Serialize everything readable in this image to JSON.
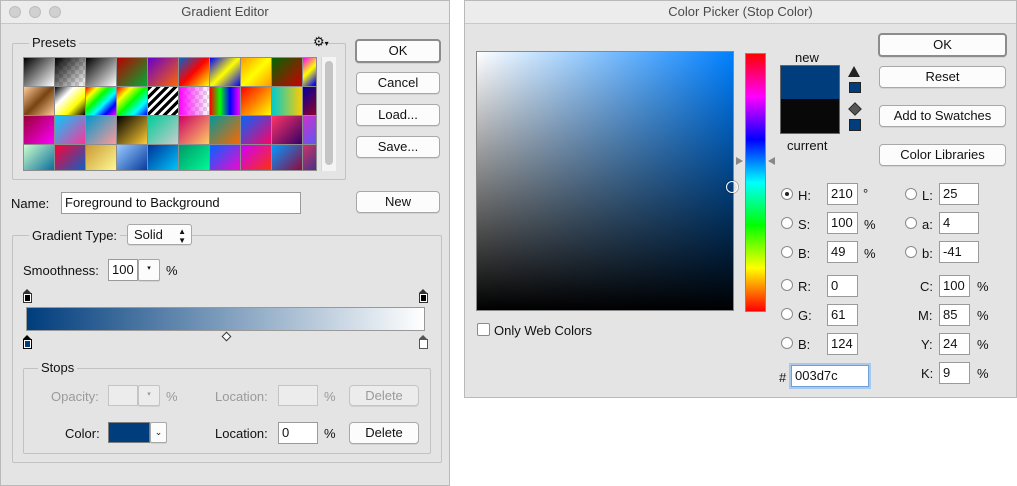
{
  "gradient_editor": {
    "title": "Gradient Editor",
    "presets_label": "Presets",
    "gear_glyph": "⚙",
    "buttons": {
      "ok": "OK",
      "cancel": "Cancel",
      "load": "Load...",
      "save": "Save...",
      "new": "New"
    },
    "name_label": "Name:",
    "name_value": "Foreground to Background",
    "gradient_type_label": "Gradient Type:",
    "gradient_type_value": "Solid",
    "smoothness_label": "Smoothness:",
    "smoothness_value": "100",
    "percent": "%",
    "stops": {
      "label": "Stops",
      "opacity_label": "Opacity:",
      "location_label": "Location:",
      "color_label": "Color:",
      "location_value": "0",
      "delete_label": "Delete"
    },
    "colors": {
      "start": "#003d7c",
      "end": "#ffffff"
    }
  },
  "color_picker": {
    "title": "Color Picker (Stop Color)",
    "buttons": {
      "ok": "OK",
      "reset": "Reset",
      "add_to_swatches": "Add to Swatches",
      "color_libraries": "Color Libraries"
    },
    "new_label": "new",
    "current_label": "current",
    "only_web_colors": "Only Web Colors",
    "hsb": [
      {
        "label": "H:",
        "value": "210",
        "unit": "°"
      },
      {
        "label": "S:",
        "value": "100",
        "unit": "%"
      },
      {
        "label": "B:",
        "value": "49",
        "unit": "%"
      }
    ],
    "rgb": [
      {
        "label": "R:",
        "value": "0"
      },
      {
        "label": "G:",
        "value": "61"
      },
      {
        "label": "B:",
        "value": "124"
      }
    ],
    "lab": [
      {
        "label": "L:",
        "value": "25"
      },
      {
        "label": "a:",
        "value": "4"
      },
      {
        "label": "b:",
        "value": "-41"
      }
    ],
    "cmyk": [
      {
        "label": "C:",
        "value": "100",
        "unit": "%"
      },
      {
        "label": "M:",
        "value": "85",
        "unit": "%"
      },
      {
        "label": "Y:",
        "value": "24",
        "unit": "%"
      },
      {
        "label": "K:",
        "value": "9",
        "unit": "%"
      }
    ],
    "hex_label": "#",
    "hex_value": "003d7c",
    "colors": {
      "new": "#003d7c",
      "current": "#080808",
      "hue_field": "#0080ff"
    }
  }
}
